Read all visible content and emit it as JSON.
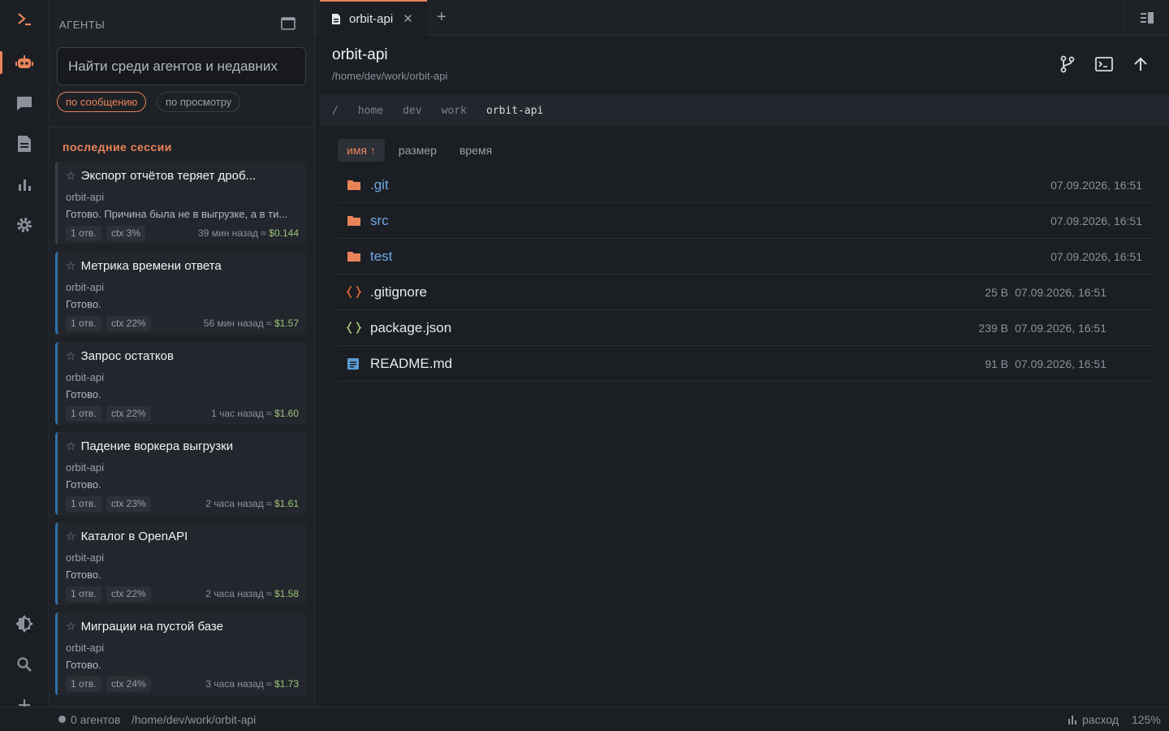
{
  "sidebar": {
    "title": "АГЕНТЫ",
    "search_placeholder": "Найти среди агентов и недавних",
    "filters": [
      "по сообщению",
      "по просмотру"
    ],
    "section_label": "последние сессии",
    "sessions": [
      {
        "title": "Экспорт отчётов теряет дроб...",
        "project": "orbit-api",
        "message": "Готово. Причина была не в выгрузке, а в ти...",
        "replies": "1 отв.",
        "ctx": "ctx 3%",
        "time": "39 мин назад ≈",
        "cost": "$0.144"
      },
      {
        "title": "Метрика времени ответа",
        "project": "orbit-api",
        "message": "Готово.",
        "replies": "1 отв.",
        "ctx": "ctx 22%",
        "time": "56 мин назад ≈",
        "cost": "$1.57"
      },
      {
        "title": "Запрос остатков",
        "project": "orbit-api",
        "message": "Готово.",
        "replies": "1 отв.",
        "ctx": "ctx 22%",
        "time": "1 час назад ≈",
        "cost": "$1.60"
      },
      {
        "title": "Падение воркера выгрузки",
        "project": "orbit-api",
        "message": "Готово.",
        "replies": "1 отв.",
        "ctx": "ctx 23%",
        "time": "2 часа назад ≈",
        "cost": "$1.61"
      },
      {
        "title": "Каталог в OpenAPI",
        "project": "orbit-api",
        "message": "Готово.",
        "replies": "1 отв.",
        "ctx": "ctx 22%",
        "time": "2 часа назад ≈",
        "cost": "$1.58"
      },
      {
        "title": "Миграции на пустой базе",
        "project": "orbit-api",
        "message": "Готово.",
        "replies": "1 отв.",
        "ctx": "ctx 24%",
        "time": "3 часа назад ≈",
        "cost": "$1.73"
      }
    ]
  },
  "tabs": [
    {
      "label": "orbit-api",
      "icon": "document-icon"
    }
  ],
  "header": {
    "title": "orbit-api",
    "path": "/home/dev/work/orbit-api"
  },
  "breadcrumbs": [
    "/",
    "home",
    "dev",
    "work",
    "orbit-api"
  ],
  "sort": [
    "имя ↑",
    "размер",
    "время"
  ],
  "files": [
    {
      "name": ".git",
      "kind": "dir",
      "size": "",
      "date": "07.09.2026, 16:51"
    },
    {
      "name": "src",
      "kind": "dir",
      "size": "",
      "date": "07.09.2026, 16:51"
    },
    {
      "name": "test",
      "kind": "dir",
      "size": "",
      "date": "07.09.2026, 16:51"
    },
    {
      "name": ".gitignore",
      "kind": "file",
      "size": "25 B",
      "date": "07.09.2026, 16:51"
    },
    {
      "name": "package.json",
      "kind": "file",
      "size": "239 B",
      "date": "07.09.2026, 16:51"
    },
    {
      "name": "README.md",
      "kind": "file",
      "size": "91 B",
      "date": "07.09.2026, 16:51"
    }
  ],
  "status": {
    "agents": "0 агентов",
    "path": "/home/dev/work/orbit-api",
    "spend": "расход",
    "zoom": "125%"
  },
  "colors": {
    "accent": "#e8835a",
    "folder": "#e8835a",
    "dir_text": "#6ea8e4",
    "cost": "#9ec27a",
    "session_border": "#2f6fa8"
  }
}
